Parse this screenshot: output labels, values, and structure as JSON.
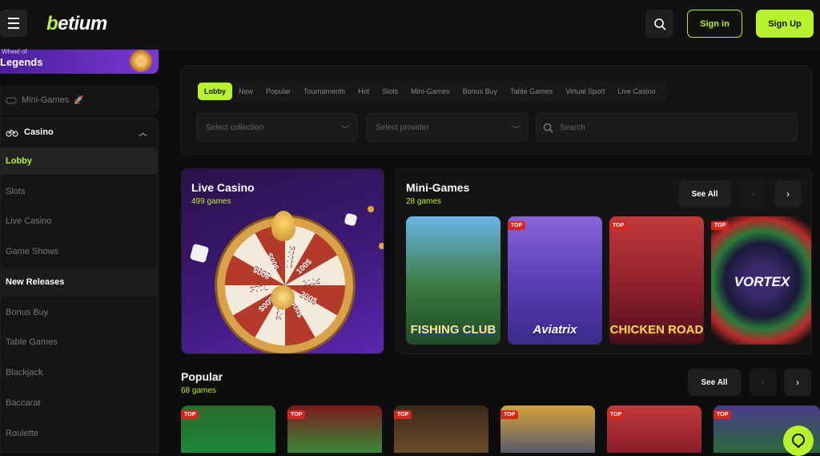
{
  "header": {
    "logo_text": "betium",
    "signin_label": "Sign in",
    "signup_label": "Sign Up",
    "accent": "#b8f12e"
  },
  "sidebar": {
    "promo_small": "Wheel of",
    "promo_title": "Legends",
    "minigames_label": "Mini-Games",
    "casino_label": "Casino",
    "items": [
      {
        "label": "Lobby"
      },
      {
        "label": "Slots"
      },
      {
        "label": "Live Casino"
      },
      {
        "label": "Game Shows"
      },
      {
        "label": "New Releases"
      },
      {
        "label": "Bonus Buy"
      },
      {
        "label": "Table Games"
      },
      {
        "label": "Blackjack"
      },
      {
        "label": "Baccarat"
      },
      {
        "label": "Roulette"
      }
    ]
  },
  "filters": {
    "tabs": [
      "Lobby",
      "New",
      "Popular",
      "Tournaments",
      "Hot",
      "Slots",
      "Mini-Games",
      "Bonus Buy",
      "Table Games",
      "Virtual Sport",
      "Live Casino"
    ],
    "collection_placeholder": "Select collection",
    "provider_placeholder": "Select provider",
    "search_placeholder": "Search"
  },
  "live_casino": {
    "title": "Live Casino",
    "count": "499 games",
    "wheel_labels": [
      "1000$",
      "100$",
      "200$",
      "300$",
      "400$",
      "500$",
      "600$",
      "700$",
      "800$",
      "900$"
    ]
  },
  "mini_games": {
    "title": "Mini-Games",
    "count": "28 games",
    "see_all": "See All",
    "games": [
      {
        "name": "FISHING CLUB",
        "badge": ""
      },
      {
        "name": "Aviatrix",
        "badge": "TOP"
      },
      {
        "name": "CHICKEN ROAD",
        "badge": "TOP"
      },
      {
        "name": "VORTEX",
        "badge": "TOP"
      }
    ]
  },
  "popular": {
    "title": "Popular",
    "count": "68 games",
    "see_all": "See All",
    "badges": [
      "TOP",
      "TOP",
      "TOP",
      "TOP",
      "TOP",
      "TOP"
    ]
  }
}
